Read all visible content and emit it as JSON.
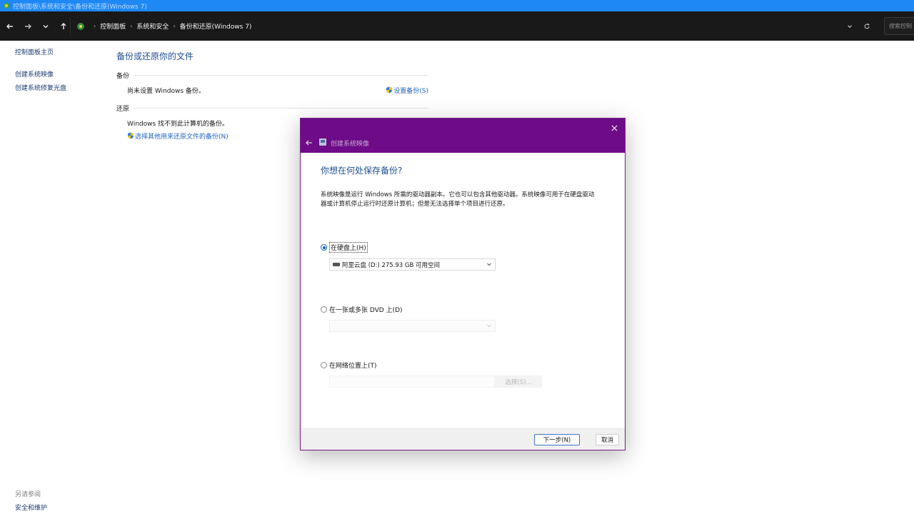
{
  "window": {
    "title": "控制面板\\系统和安全\\备份和还原(Windows 7)"
  },
  "addressbar": {
    "breadcrumbs": [
      "控制面板",
      "系统和安全",
      "备份和还原(Windows 7)"
    ],
    "search_placeholder": "搜索控制"
  },
  "leftpane": {
    "items": [
      {
        "label": "控制面板主页"
      },
      {
        "label": "创建系统映像"
      },
      {
        "label": "创建系统修复光盘"
      }
    ],
    "see_also": {
      "heading": "另请参阅",
      "items": [
        {
          "label": "安全和维护"
        }
      ]
    }
  },
  "main": {
    "title": "备份或还原你的文件",
    "backup": {
      "heading": "备份",
      "status": "尚未设置 Windows 备份。",
      "setup_link": "设置备份(S)"
    },
    "restore": {
      "heading": "还原",
      "status": "Windows 找不到此计算机的备份。",
      "select_link": "选择其他用来还原文件的备份(N)"
    }
  },
  "dialog": {
    "title": "创建系统映像",
    "question": "你想在何处保存备份?",
    "description": "系统映像是运行 Windows 所需的驱动器副本。它也可以包含其他驱动器。系统映像可用于在硬盘驱动器或计算机停止运行时还原计算机；但是无法选择单个项目进行还原。",
    "options": {
      "harddisk": {
        "label": "在硬盘上(H)",
        "selected": true,
        "drive": "阿里云盘 (D:)  275.93 GB 可用空间"
      },
      "dvd": {
        "label": "在一张或多张 DVD 上(D)",
        "selected": false
      },
      "network": {
        "label": "在网络位置上(T)",
        "selected": false,
        "choose_label": "选择(S)..."
      }
    },
    "buttons": {
      "next": "下一步(N)",
      "cancel": "取消"
    }
  },
  "colors": {
    "titlebar": "#1e88f5",
    "dialog_header": "#6e0b88",
    "link": "#1f65c4",
    "heading": "#1e4e94"
  }
}
